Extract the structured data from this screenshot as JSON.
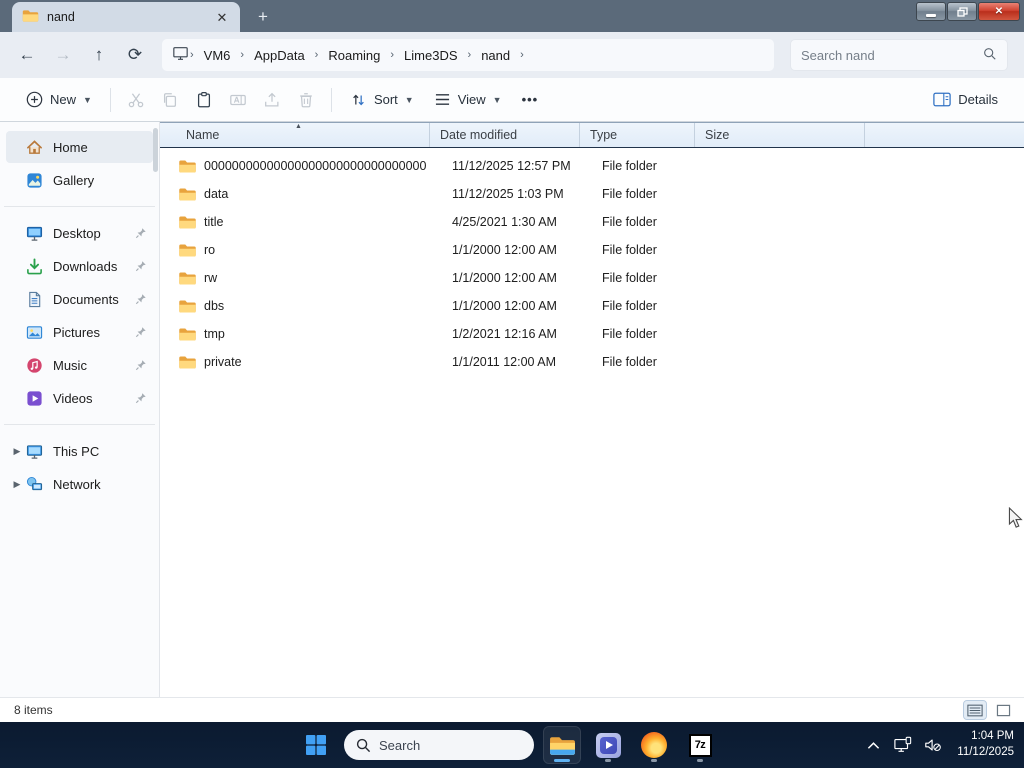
{
  "window": {
    "tab_title": "nand",
    "controls": [
      "minimize-button",
      "maximize-button",
      "close-button"
    ],
    "new_tab_label": "+"
  },
  "navbar": {
    "buttons": [
      "back",
      "forward",
      "up",
      "refresh"
    ],
    "breadcrumbs": [
      "VM6",
      "AppData",
      "Roaming",
      "Lime3DS",
      "nand"
    ],
    "breadcrumb_root_icon": "this-pc-icon",
    "search_placeholder": "Search nand"
  },
  "toolbar": {
    "new_label": "New",
    "sort_label": "Sort",
    "view_label": "View",
    "more_label": "•••",
    "details_label": "Details",
    "icon_buttons": [
      "cut",
      "copy",
      "paste",
      "rename",
      "share",
      "delete"
    ],
    "disabled_buttons": [
      "cut",
      "copy",
      "rename",
      "share",
      "delete"
    ]
  },
  "sidebar": {
    "items": [
      {
        "label": "Home",
        "icon": "home",
        "selected": true
      },
      {
        "label": "Gallery",
        "icon": "gallery"
      },
      {
        "divider": true
      },
      {
        "label": "Desktop",
        "icon": "desktop",
        "pinned": true
      },
      {
        "label": "Downloads",
        "icon": "downloads",
        "pinned": true
      },
      {
        "label": "Documents",
        "icon": "documents",
        "pinned": true
      },
      {
        "label": "Pictures",
        "icon": "pictures",
        "pinned": true
      },
      {
        "label": "Music",
        "icon": "music",
        "pinned": true
      },
      {
        "label": "Videos",
        "icon": "videos",
        "pinned": true
      },
      {
        "divider": true
      },
      {
        "label": "This PC",
        "icon": "thispc",
        "expandable": true
      },
      {
        "label": "Network",
        "icon": "network",
        "expandable": true
      }
    ]
  },
  "list": {
    "columns": [
      "Name",
      "Date modified",
      "Type",
      "Size"
    ],
    "sort": {
      "column": "Name",
      "direction": "ascending"
    },
    "rows": [
      {
        "name": "00000000000000000000000000000000",
        "date": "11/12/2025 12:57 PM",
        "type": "File folder",
        "size": ""
      },
      {
        "name": "data",
        "date": "11/12/2025 1:03 PM",
        "type": "File folder",
        "size": ""
      },
      {
        "name": "title",
        "date": "4/25/2021 1:30 AM",
        "type": "File folder",
        "size": ""
      },
      {
        "name": "ro",
        "date": "1/1/2000 12:00 AM",
        "type": "File folder",
        "size": ""
      },
      {
        "name": "rw",
        "date": "1/1/2000 12:00 AM",
        "type": "File folder",
        "size": ""
      },
      {
        "name": "dbs",
        "date": "1/1/2000 12:00 AM",
        "type": "File folder",
        "size": ""
      },
      {
        "name": "tmp",
        "date": "1/2/2021 12:16 AM",
        "type": "File folder",
        "size": ""
      },
      {
        "name": "private",
        "date": "1/1/2011 12:00 AM",
        "type": "File folder",
        "size": ""
      }
    ]
  },
  "statusbar": {
    "items_text": "8 items",
    "view_toggles": [
      "details-view",
      "large-icons-view"
    ],
    "active_view": "details-view"
  },
  "taskbar": {
    "search_placeholder": "Search",
    "apps": [
      {
        "name": "file-explorer",
        "state": "active"
      },
      {
        "name": "media-player",
        "state": "running"
      },
      {
        "name": "firefox",
        "state": "running"
      },
      {
        "name": "7zip",
        "state": "running"
      }
    ],
    "tray_icons": [
      "tray-chevron",
      "network",
      "volume-muted"
    ],
    "clock": {
      "time": "1:04 PM",
      "date": "11/12/2025"
    }
  },
  "colors": {
    "titlebar": "#5b6a7a",
    "tab": "#d2dbe6",
    "taskbar": "#0c1c33",
    "accent_blue": "#5fb2f2",
    "folder_front": "#ffd97e",
    "folder_back": "#e8a33d",
    "close_button": "#c93a26",
    "header_bg": "#e8f1fa"
  }
}
